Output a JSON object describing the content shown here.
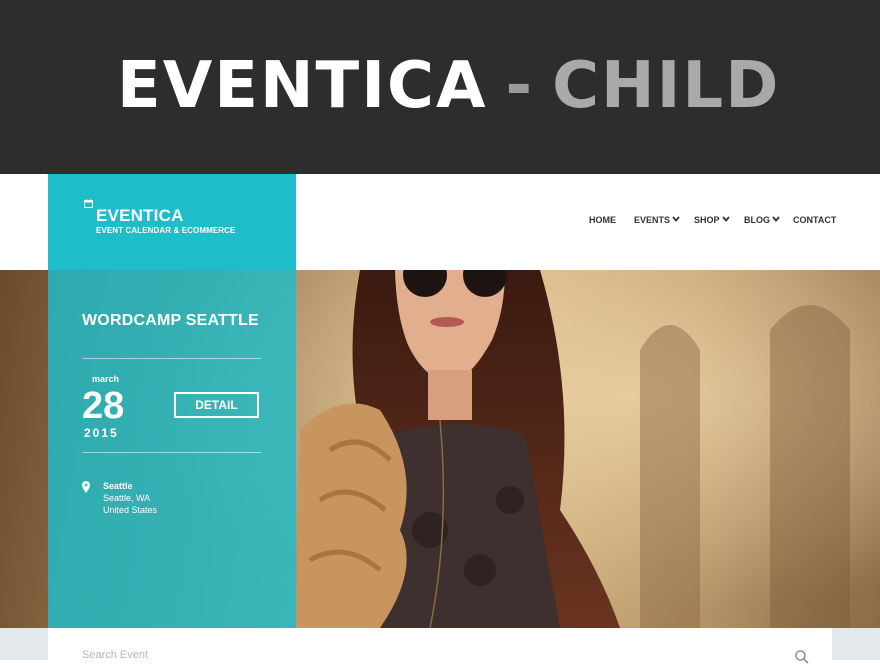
{
  "banner": {
    "title": "EVENTICA",
    "separator": "-",
    "subtitle": "CHILD"
  },
  "logo": {
    "name": "EVENTICA",
    "tagline": "EVENT CALENDAR & ECOMMERCE",
    "icon": "calendar-icon"
  },
  "nav": {
    "items": [
      {
        "label": "HOME",
        "has_dropdown": false
      },
      {
        "label": "EVENTS",
        "has_dropdown": true
      },
      {
        "label": "SHOP",
        "has_dropdown": true
      },
      {
        "label": "BLOG",
        "has_dropdown": true
      },
      {
        "label": "CONTACT",
        "has_dropdown": false
      }
    ]
  },
  "event": {
    "title": "WORDCAMP SEATTLE",
    "month": "march",
    "day": "28",
    "year": "2015",
    "detail_label": "DETAIL",
    "location": {
      "name": "Seattle",
      "city": "Seattle, WA",
      "country": "United States",
      "icon": "map-pin-icon"
    }
  },
  "search": {
    "placeholder": "Search Event",
    "icon": "search-icon"
  },
  "colors": {
    "accent": "#1ebdc9",
    "banner_bg": "#2d2d2d",
    "nav_text": "#333333"
  }
}
